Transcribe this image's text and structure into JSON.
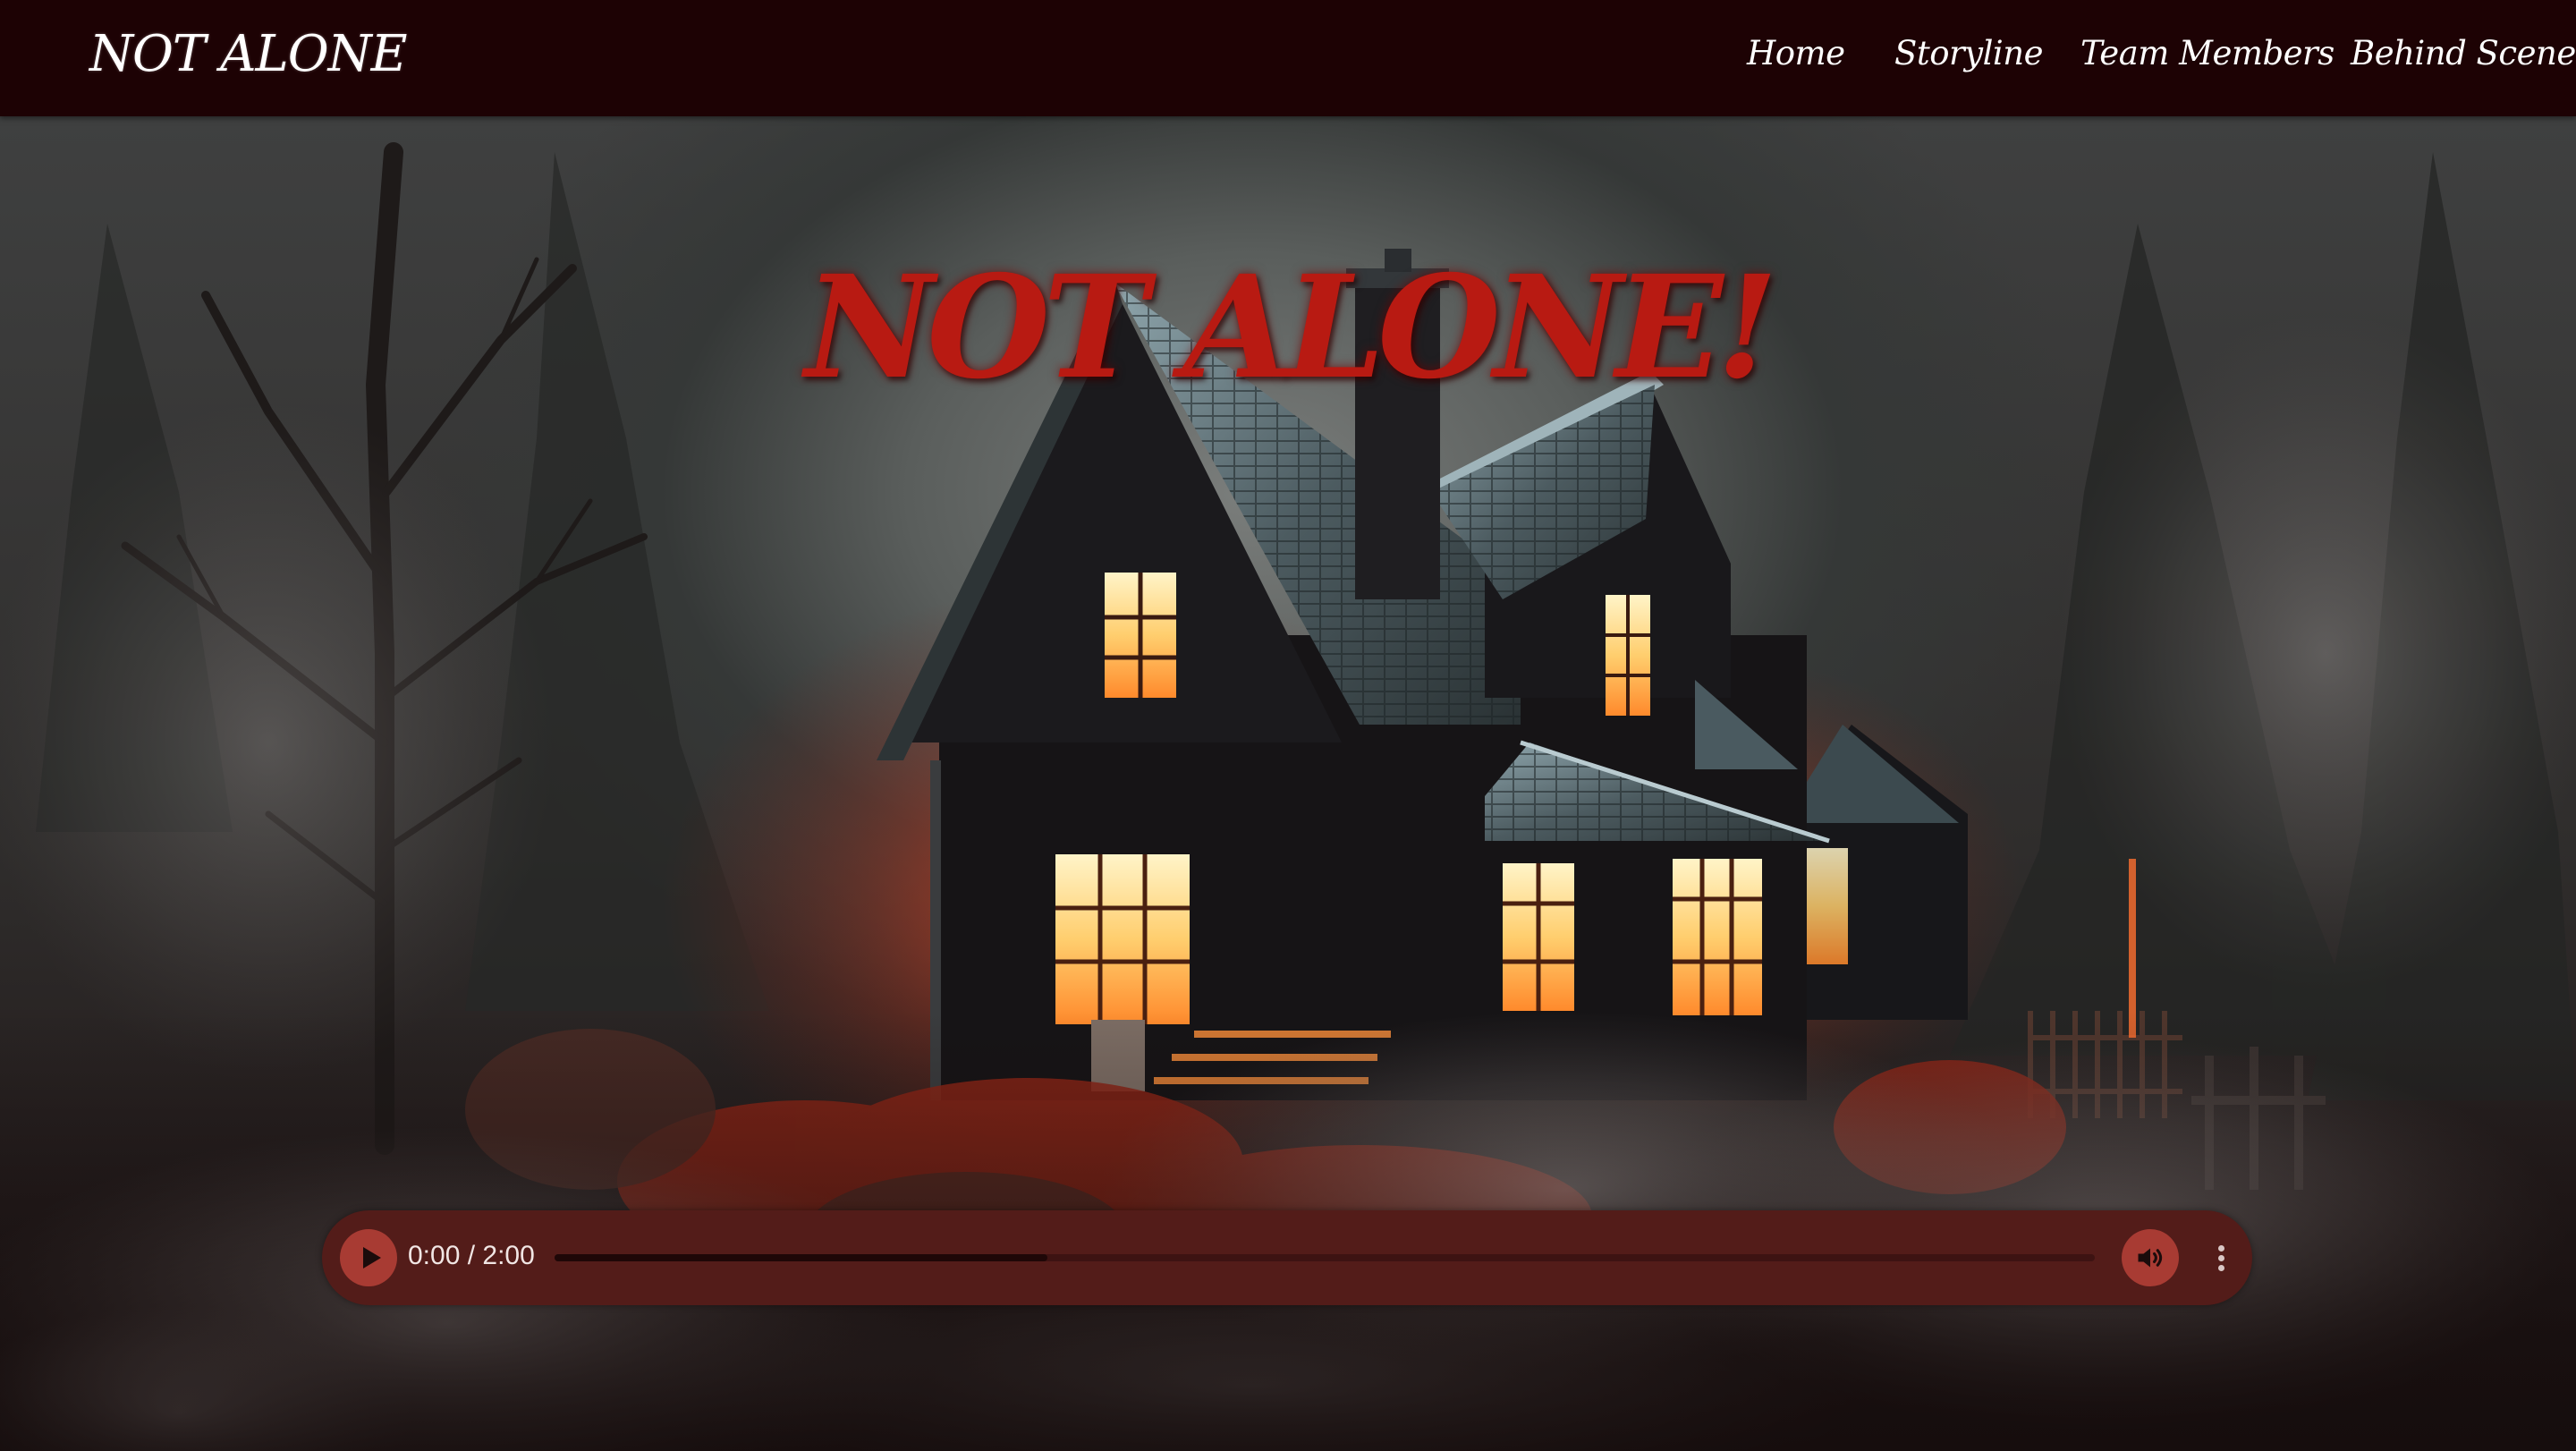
{
  "navbar": {
    "brand": "NOT ALONE",
    "links": [
      {
        "label": "Home"
      },
      {
        "label": "Storyline"
      },
      {
        "label": "Team Members"
      },
      {
        "label": "Behind Scenes"
      }
    ]
  },
  "hero": {
    "title": "NOT ALONE!",
    "image": "haunted-house-at-night-foggy-forest"
  },
  "audio_player": {
    "time": "0:00 / 2:00",
    "current_time": "0:00",
    "duration": "2:00",
    "buffered_fraction": 0.32,
    "icons": {
      "play": "play-icon",
      "volume": "volume-icon",
      "more": "more-options-icon"
    }
  },
  "colors": {
    "nav_background": "#1d0204",
    "title_red": "#b81a12",
    "player_background": "#531c19",
    "player_button": "#a83b33"
  }
}
